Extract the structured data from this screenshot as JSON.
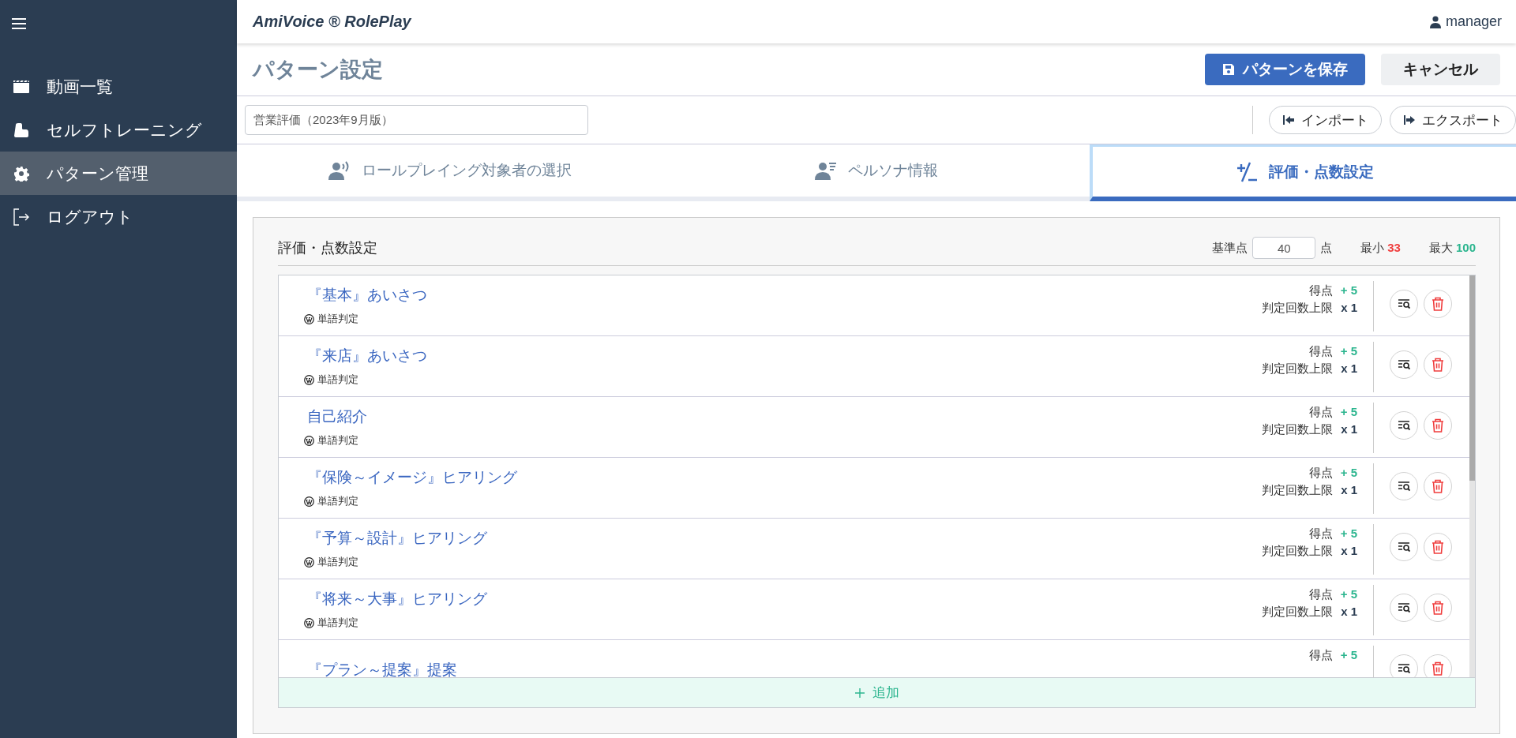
{
  "sidebar": {
    "items": [
      {
        "label": "動画一覧",
        "selected": false
      },
      {
        "label": "セルフトレーニング",
        "selected": false
      },
      {
        "label": "パターン管理",
        "selected": true
      },
      {
        "label": "ログアウト",
        "selected": false
      }
    ]
  },
  "header": {
    "brand": "AmiVoice ® RolePlay",
    "user": "manager"
  },
  "page": {
    "title": "パターン設定",
    "save_button": "パターンを保存",
    "cancel_button": "キャンセル",
    "pattern_name": "営業評価（2023年9月版）",
    "import_button": "インポート",
    "export_button": "エクスポート"
  },
  "tabs": [
    {
      "label": "ロールプレイング対象者の選択",
      "selected": false
    },
    {
      "label": "ペルソナ情報",
      "selected": false
    },
    {
      "label": "評価・点数設定",
      "selected": true
    }
  ],
  "section": {
    "title": "評価・点数設定",
    "base_label": "基準点",
    "base_value": "40",
    "base_unit": "点",
    "min_label": "最小",
    "min_value": "33",
    "max_label": "最大",
    "max_value": "100"
  },
  "items": [
    {
      "title": "『基本』あいさつ",
      "tag": "単語判定",
      "score_label": "得点",
      "score": "+ 5",
      "limit_label": "判定回数上限",
      "limit": "x 1"
    },
    {
      "title": "『来店』あいさつ",
      "tag": "単語判定",
      "score_label": "得点",
      "score": "+ 5",
      "limit_label": "判定回数上限",
      "limit": "x 1"
    },
    {
      "title": "自己紹介",
      "tag": "単語判定",
      "score_label": "得点",
      "score": "+ 5",
      "limit_label": "判定回数上限",
      "limit": "x 1"
    },
    {
      "title": "『保険～イメージ』ヒアリング",
      "tag": "単語判定",
      "score_label": "得点",
      "score": "+ 5",
      "limit_label": "判定回数上限",
      "limit": "x 1"
    },
    {
      "title": "『予算～設計』ヒアリング",
      "tag": "単語判定",
      "score_label": "得点",
      "score": "+ 5",
      "limit_label": "判定回数上限",
      "limit": "x 1"
    },
    {
      "title": "『将来～大事』ヒアリング",
      "tag": "単語判定",
      "score_label": "得点",
      "score": "+ 5",
      "limit_label": "判定回数上限",
      "limit": "x 1"
    },
    {
      "title": "『プラン～提案』提案",
      "score_label": "得点",
      "score": "+ 5"
    }
  ],
  "add_button": "追加"
}
